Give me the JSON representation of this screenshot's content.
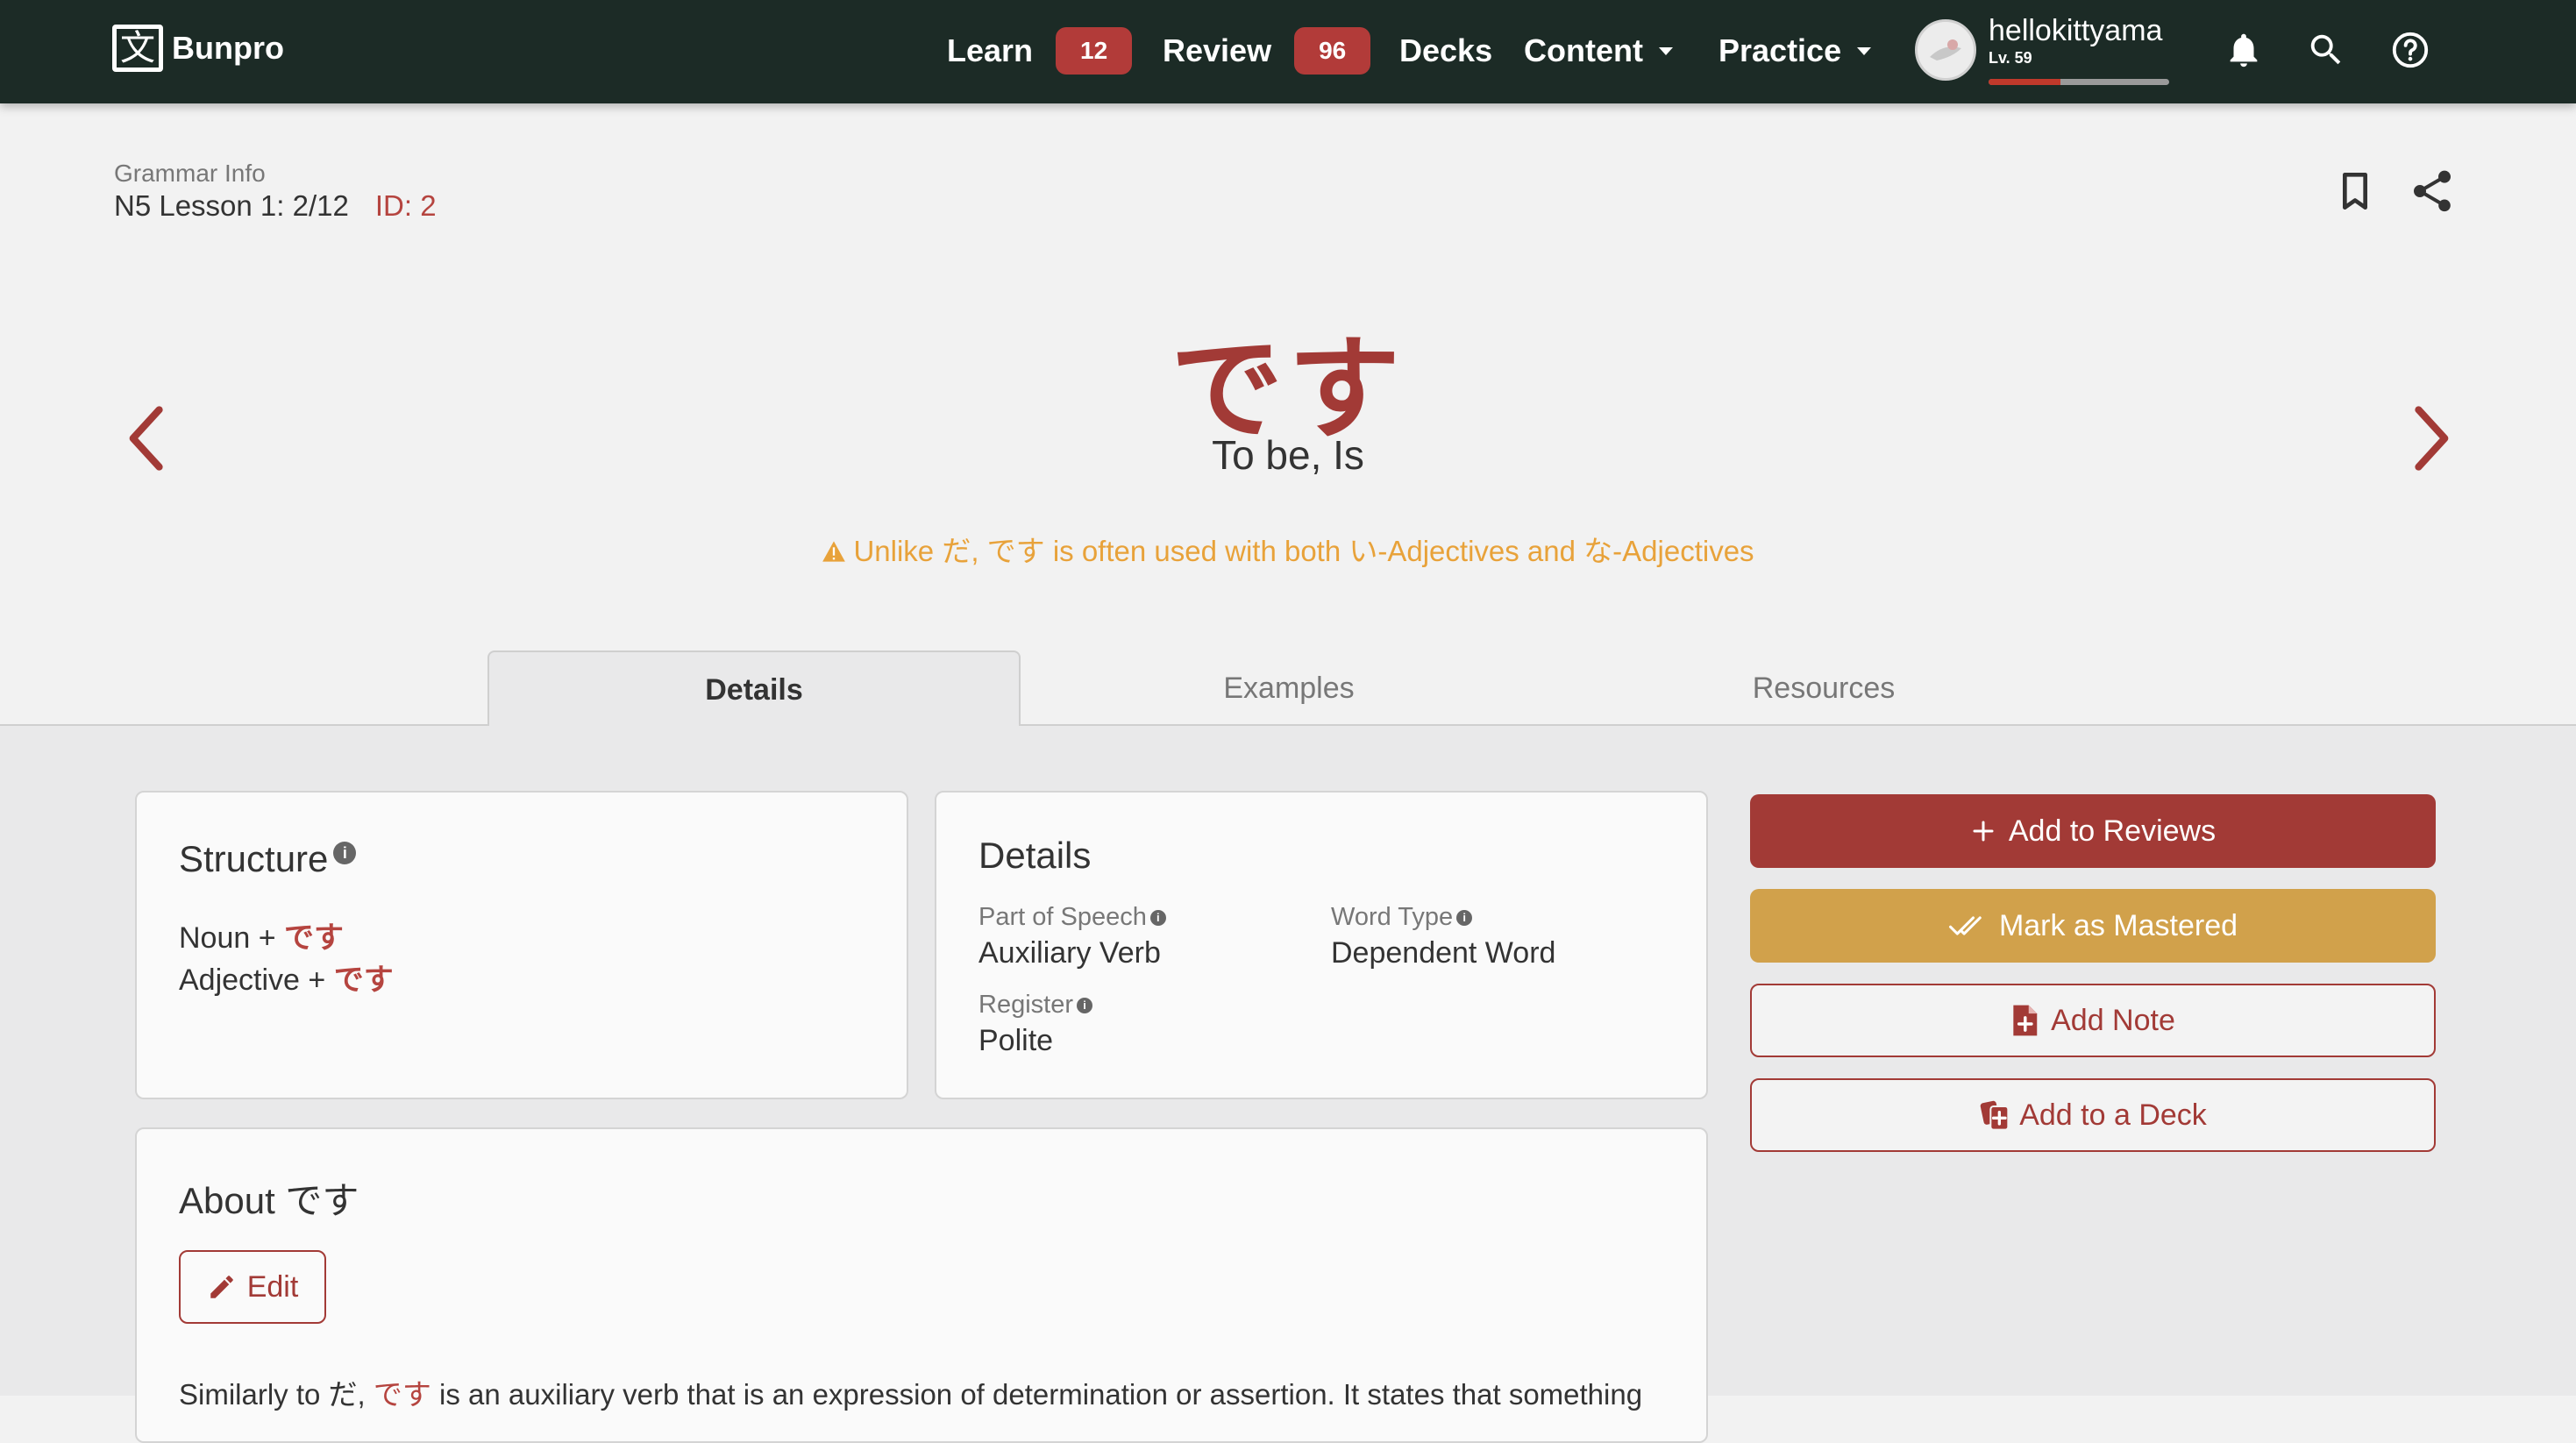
{
  "nav": {
    "logo_glyph": "文",
    "logo_text": "Bunpro",
    "learn_label": "Learn",
    "learn_count": "12",
    "review_label": "Review",
    "review_count": "96",
    "decks_label": "Decks",
    "content_label": "Content",
    "practice_label": "Practice",
    "username": "hellokittyama",
    "level": "Lv. 59",
    "level_progress": 0.4
  },
  "header": {
    "section_label": "Grammar Info",
    "lesson": "N5 Lesson 1: 2/12",
    "id_label": "ID: 2",
    "title": "です",
    "meaning": "To be, Is",
    "warning": "Unlike だ, です is often used with both い-Adjectives and な-Adjectives"
  },
  "tabs": [
    {
      "label": "Details",
      "active": true
    },
    {
      "label": "Examples",
      "active": false
    },
    {
      "label": "Resources",
      "active": false
    }
  ],
  "structure": {
    "title": "Structure",
    "info_glyph": "i",
    "lines": [
      {
        "prefix": "Noun + ",
        "suffix": "です"
      },
      {
        "prefix": "Adjective + ",
        "suffix": "です"
      }
    ]
  },
  "details": {
    "title": "Details",
    "part_of_speech_label": "Part of Speech",
    "part_of_speech": "Auxiliary Verb",
    "word_type_label": "Word Type",
    "word_type": "Dependent Word",
    "register_label": "Register",
    "register": "Polite"
  },
  "actions": {
    "add_reviews": "Add to Reviews",
    "mark_mastered": "Mark as Mastered",
    "add_note": "Add Note",
    "add_deck": "Add to a Deck"
  },
  "about": {
    "title": "About です",
    "edit_label": "Edit",
    "text_before": "Similarly to だ, ",
    "text_highlight": "です",
    "text_after": " is an auxiliary verb that is an expression of determination or assertion. It states that something"
  },
  "colors": {
    "nav_bg": "#1c2b26",
    "accent_red": "#a23a36",
    "gold": "#d1a14b",
    "warning": "#e8a23a"
  },
  "icons": [
    "bell-icon",
    "search-icon",
    "help-icon",
    "bookmark-icon",
    "share-icon",
    "chevron-left-icon",
    "chevron-right-icon",
    "warning-icon",
    "plus-icon",
    "double-check-icon",
    "note-add-icon",
    "deck-add-icon",
    "pencil-icon",
    "info-icon",
    "caret-down-icon"
  ]
}
